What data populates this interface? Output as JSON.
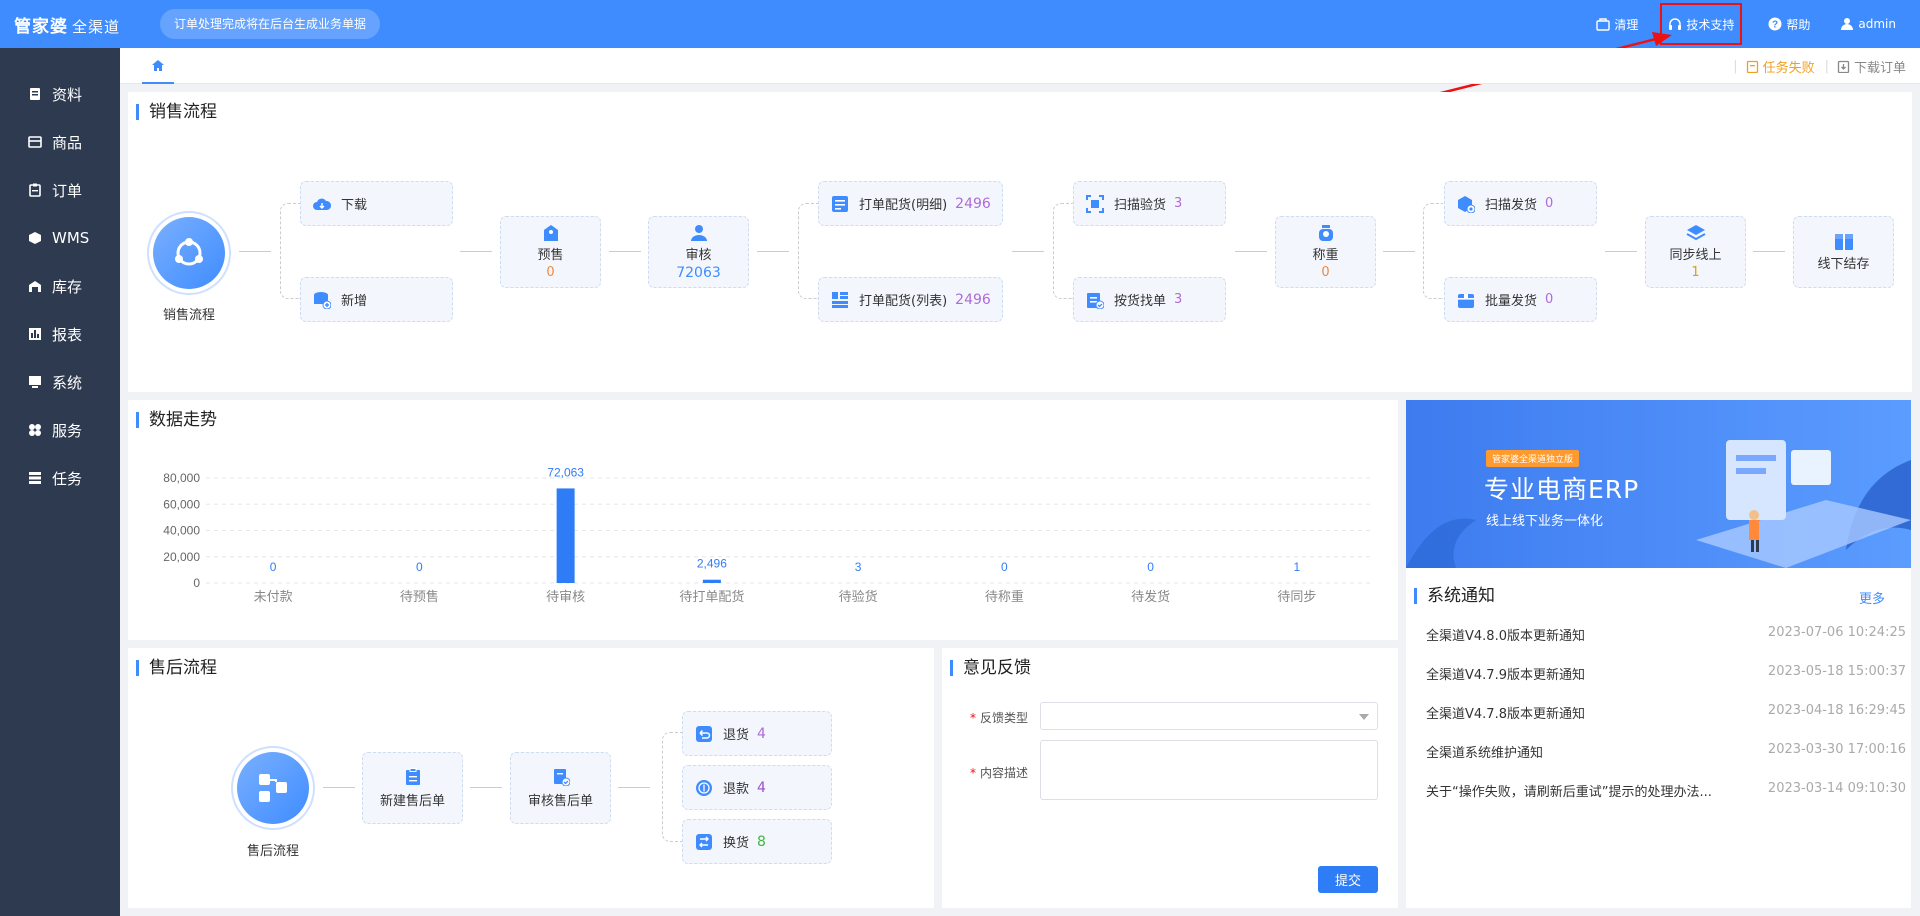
{
  "app": {
    "logo_main": "管家婆",
    "logo_sub": "全渠道",
    "notice": "订单处理完成将在后台生成业务单据"
  },
  "top_actions": {
    "clear": "清理",
    "support": "技术支持",
    "help": "帮助",
    "user": "admin"
  },
  "sidebar": {
    "items": [
      {
        "label": "资料",
        "icon": "file-icon"
      },
      {
        "label": "商品",
        "icon": "box-icon"
      },
      {
        "label": "订单",
        "icon": "clipboard-icon"
      },
      {
        "label": "WMS",
        "icon": "cube-icon"
      },
      {
        "label": "库存",
        "icon": "warehouse-icon"
      },
      {
        "label": "报表",
        "icon": "bar-chart-icon"
      },
      {
        "label": "系统",
        "icon": "monitor-icon"
      },
      {
        "label": "服务",
        "icon": "grid-icon"
      },
      {
        "label": "任务",
        "icon": "list-icon"
      }
    ]
  },
  "tabbar": {
    "task_fail": "任务失败",
    "download_orders": "下载订单"
  },
  "sales": {
    "title": "销售流程",
    "root": "销售流程",
    "download": "下载",
    "add": "新增",
    "presale": {
      "label": "预售",
      "value": "0"
    },
    "audit": {
      "label": "审核",
      "value": "72063"
    },
    "print_detail": {
      "label": "打单配货(明细)",
      "value": "2496"
    },
    "print_list": {
      "label": "打单配货(列表)",
      "value": "2496"
    },
    "scan_check": {
      "label": "扫描验货",
      "value": "3"
    },
    "pick_by_goods": {
      "label": "按货找单",
      "value": "3"
    },
    "weigh": {
      "label": "称重",
      "value": "0"
    },
    "scan_ship": {
      "label": "扫描发货",
      "value": "0"
    },
    "batch_ship": {
      "label": "批量发货",
      "value": "0"
    },
    "sync_online": {
      "label": "同步线上",
      "value": "1"
    },
    "offline_settle": {
      "label": "线下结存"
    }
  },
  "trend": {
    "title": "数据走势"
  },
  "chart_data": {
    "type": "bar",
    "categories": [
      "未付款",
      "待预售",
      "待审核",
      "待打单配货",
      "待验货",
      "待称重",
      "待发货",
      "待同步"
    ],
    "values": [
      0,
      0,
      72063,
      2496,
      3,
      0,
      0,
      1
    ],
    "value_labels": [
      "0",
      "0",
      "72,063",
      "2,496",
      "3",
      "0",
      "0",
      "1"
    ],
    "yticks": [
      "0",
      "20,000",
      "40,000",
      "60,000",
      "80,000"
    ],
    "ylim": [
      0,
      80000
    ],
    "grid": true,
    "color": "#2f7df6"
  },
  "banner": {
    "tag": "管家婆全渠道独立版",
    "title": "专业电商ERP",
    "subtitle": "线上线下业务一体化"
  },
  "notices": {
    "title": "系统通知",
    "more": "更多",
    "items": [
      {
        "title": "全渠道V4.8.0版本更新通知",
        "date": "2023-07-06 10:24:25"
      },
      {
        "title": "全渠道V4.7.9版本更新通知",
        "date": "2023-05-18 15:00:37"
      },
      {
        "title": "全渠道V4.7.8版本更新通知",
        "date": "2023-04-18 16:29:45"
      },
      {
        "title": "全渠道系统维护通知",
        "date": "2023-03-30 17:00:16"
      },
      {
        "title": "关于“操作失败，请刷新后重试”提示的处理办法...",
        "date": "2023-03-14 09:10:30"
      }
    ]
  },
  "aftersale": {
    "title": "售后流程",
    "root": "售后流程",
    "new_order": "新建售后单",
    "audit_order": "审核售后单",
    "return_goods": {
      "label": "退货",
      "value": "4"
    },
    "refund": {
      "label": "退款",
      "value": "4"
    },
    "exchange": {
      "label": "换货",
      "value": "8"
    }
  },
  "feedback": {
    "title": "意见反馈",
    "type_label": "反馈类型",
    "content_label": "内容描述",
    "submit": "提交"
  }
}
